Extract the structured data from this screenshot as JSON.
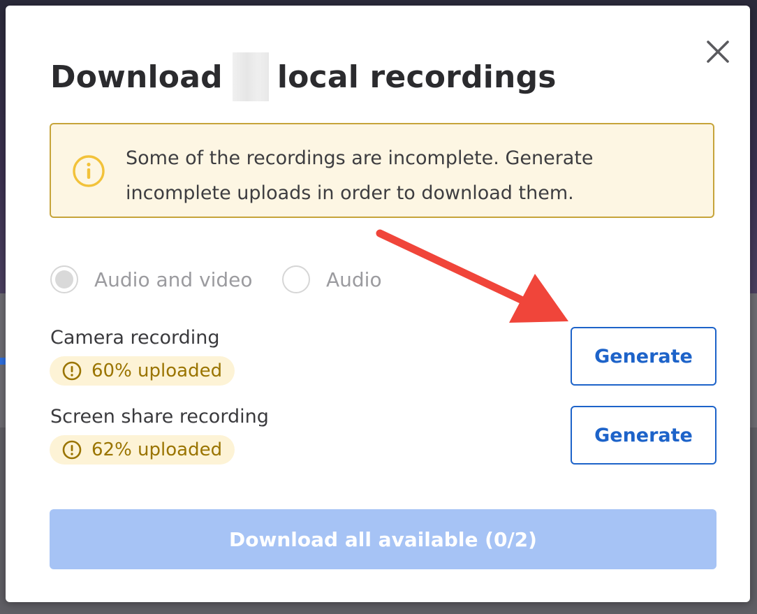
{
  "dialog": {
    "title_prefix": "Download",
    "title_suffix": "local recordings",
    "close_icon": "close-icon"
  },
  "alert": {
    "icon": "info-icon",
    "text": "Some of the recordings are incomplete. Generate incomplete uploads in order to download them.",
    "color": "#c6a43a"
  },
  "format_options": [
    {
      "label": "Audio and video",
      "selected": true
    },
    {
      "label": "Audio",
      "selected": false
    }
  ],
  "recordings": [
    {
      "name": "Camera recording",
      "status": "60% uploaded",
      "progress_percent": 60,
      "action": "Generate"
    },
    {
      "name": "Screen share recording",
      "status": "62% uploaded",
      "progress_percent": 62,
      "action": "Generate"
    }
  ],
  "download_all": {
    "label": "Download all available (0/2)",
    "enabled": false
  },
  "annotation": {
    "type": "arrow",
    "color": "#f0453a"
  },
  "colors": {
    "accent": "#1d63c9",
    "warning_text": "#9a7400",
    "warning_bg": "#fdf3d6",
    "disabled_button": "#a6c3f5"
  }
}
